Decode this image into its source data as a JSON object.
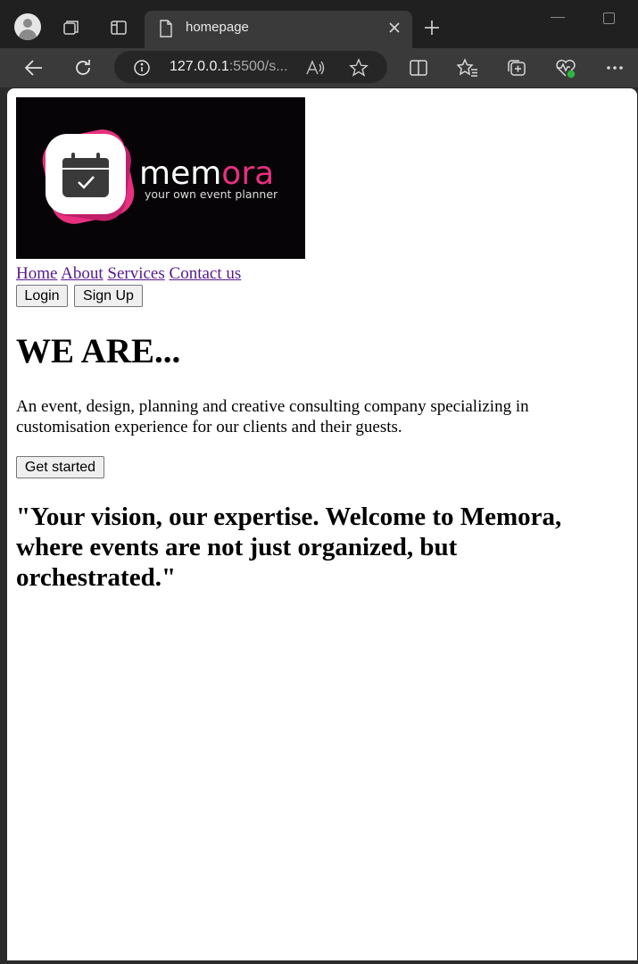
{
  "browser": {
    "tab_title": "homepage",
    "url_host": "127.0.0.1",
    "url_rest": ":5500/s..."
  },
  "logo": {
    "name": "memora",
    "tagline": "your own event planner",
    "accent_color": "#e8307f"
  },
  "nav": {
    "links": [
      "Home",
      "About",
      "Services",
      "Contact us"
    ]
  },
  "auth": {
    "login_label": "Login",
    "signup_label": "Sign Up"
  },
  "hero": {
    "heading": "WE ARE...",
    "description": "An event, design, planning and creative consulting company specializing in customisation experience for our clients and their guests.",
    "cta_label": "Get started",
    "quote": "\"Your vision, our expertise. Welcome to Memora, where events are not just organized, but orchestrated.\""
  }
}
